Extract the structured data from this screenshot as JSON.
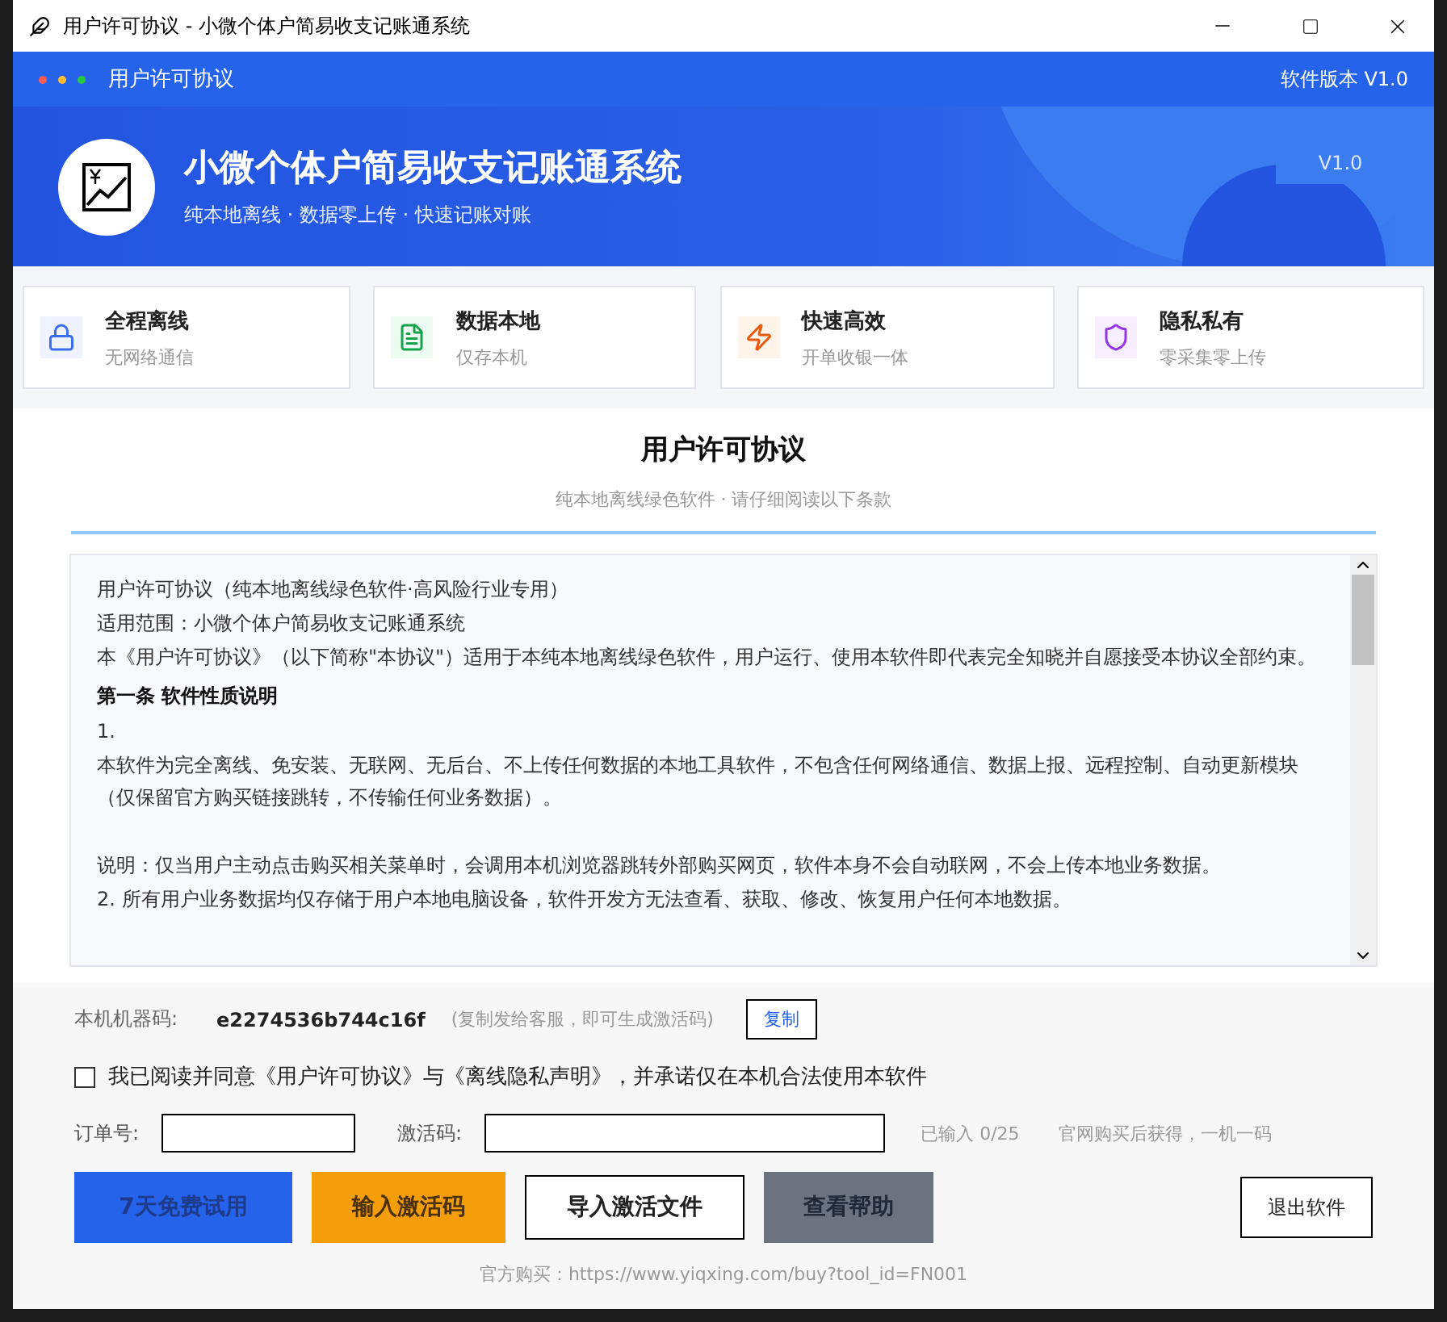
{
  "window": {
    "title": "用户许可协议 - 小微个体户简易收支记账通系统"
  },
  "header": {
    "nav_title": "用户许可协议",
    "version_label": "软件版本 V1.0",
    "app_title": "小微个体户简易收支记账通系统",
    "tagline": "纯本地离线 · 数据零上传 · 快速记账对账",
    "badge": "V1.0"
  },
  "features": [
    {
      "kind": "lock",
      "title": "全程离线",
      "subtitle": "无网络通信",
      "color": "#3b6ef5"
    },
    {
      "kind": "file",
      "title": "数据本地",
      "subtitle": "仅存本机",
      "color": "#16a34a"
    },
    {
      "kind": "bolt",
      "title": "快速高效",
      "subtitle": "开单收银一体",
      "color": "#ea580c"
    },
    {
      "kind": "shield",
      "title": "隐私私有",
      "subtitle": "零采集零上传",
      "color": "#9333ea"
    }
  ],
  "agreement": {
    "title": "用户许可协议",
    "subtitle": "纯本地离线绿色软件 · 请仔细阅读以下条款",
    "paragraphs": [
      {
        "kind": "text",
        "text": "用户许可协议（纯本地离线绿色软件·高风险行业专用）"
      },
      {
        "kind": "text",
        "text": "适用范围：小微个体户简易收支记账通系统"
      },
      {
        "kind": "text",
        "text": "本《用户许可协议》（以下简称\"本协议\"）适用于本纯本地离线绿色软件，用户运行、使用本软件即代表完全知晓并自愿接受本协议全部约束。"
      },
      {
        "kind": "heading",
        "text": "第一条 软件性质说明"
      },
      {
        "kind": "text",
        "text": "1."
      },
      {
        "kind": "text",
        "text": "本软件为完全离线、免安装、无联网、无后台、不上传任何数据的本地工具软件，不包含任何网络通信、数据上报、远程控制、自动更新模块（仅保留官方购买链接跳转，不传输任何业务数据）。"
      },
      {
        "kind": "blank"
      },
      {
        "kind": "text",
        "text": "说明：仅当用户主动点击购买相关菜单时，会调用本机浏览器跳转外部购买网页，软件本身不会自动联网，不会上传本地业务数据。"
      },
      {
        "kind": "text",
        "text": "2. 所有用户业务数据均仅存储于用户本地电脑设备，软件开发方无法查看、获取、修改、恢复用户任何本地数据。"
      }
    ]
  },
  "machine": {
    "label": "本机机器码:",
    "code": "e2274536b744c16f",
    "hint": "(复制发给客服，即可生成激活码)",
    "copy_button": "复制"
  },
  "consent": {
    "checked": false,
    "text": "我已阅读并同意《用户许可协议》与《离线隐私声明》，并承诺仅在本机合法使用本软件"
  },
  "fields": [
    {
      "kind": "order",
      "label": "订单号:"
    },
    {
      "kind": "code",
      "label": "激活码:"
    }
  ],
  "counter": "已输入 0/25",
  "field_hint": "官网购买后获得，一机一码",
  "buttons": [
    {
      "kind": "primary",
      "label": "7天免费试用"
    },
    {
      "kind": "warning",
      "label": "输入激活码"
    },
    {
      "kind": "outline",
      "label": "导入激活文件"
    },
    {
      "kind": "disabled",
      "label": "查看帮助"
    }
  ],
  "exit_button": "退出软件",
  "footer": "官方购买：https://www.yiqxing.com/buy?tool_id=FN001"
}
